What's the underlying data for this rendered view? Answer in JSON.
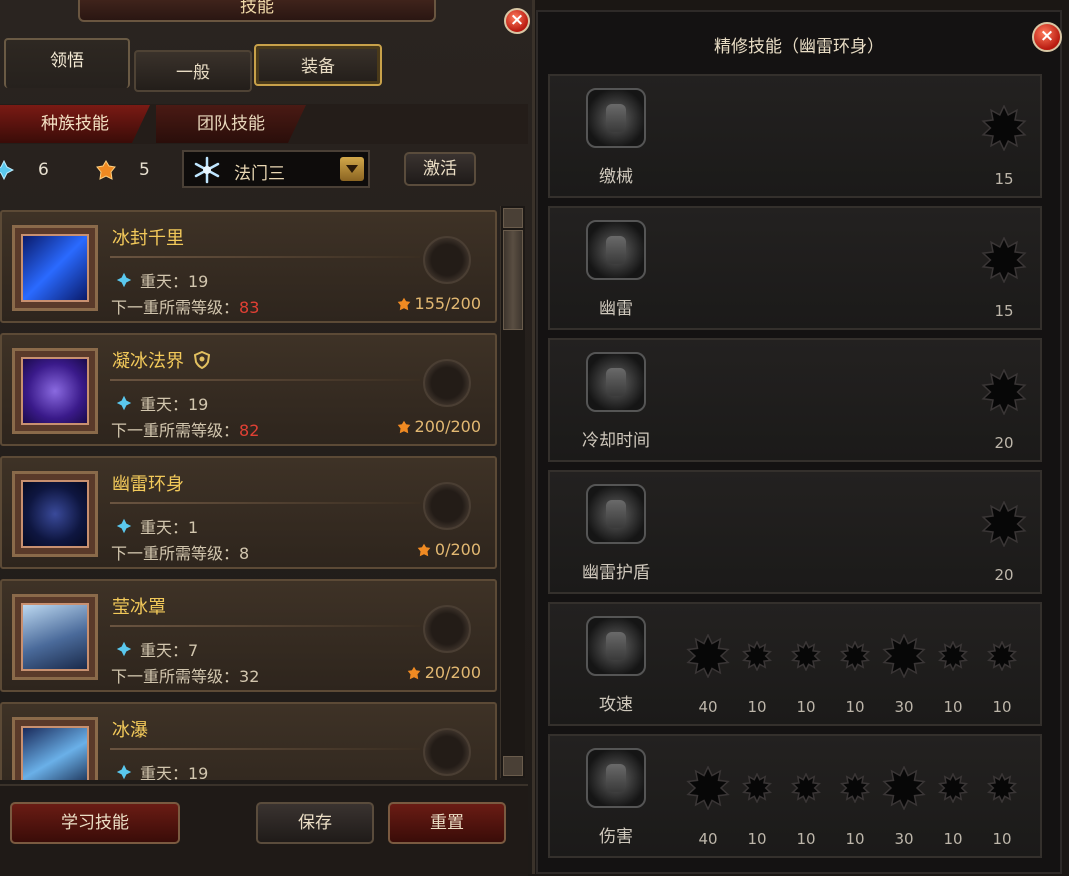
{
  "left": {
    "title": "技能",
    "tabs": [
      "领悟",
      "一般",
      "装备"
    ],
    "subtabs": [
      "种族技能",
      "团队技能"
    ],
    "resources": {
      "blue_count": "6",
      "orange_count": "5"
    },
    "dropdown": {
      "selected": "法门三"
    },
    "activate_label": "激活",
    "skills": [
      {
        "name": "冰封千里",
        "level": "重天：19",
        "req_prefix": "下一重所需等级：",
        "req_value": "83",
        "req_red": true,
        "cost": "155/200"
      },
      {
        "name": "凝冰法界",
        "level": "重天：19",
        "req_prefix": "下一重所需等级：",
        "req_value": "82",
        "req_red": true,
        "cost": "200/200"
      },
      {
        "name": "幽雷环身",
        "level": "重天：1",
        "req_prefix": "下一重所需等级：",
        "req_value": "8",
        "req_red": false,
        "cost": "0/200"
      },
      {
        "name": "莹冰罩",
        "level": "重天：7",
        "req_prefix": "下一重所需等级：",
        "req_value": "32",
        "req_red": false,
        "cost": "20/200"
      },
      {
        "name": "冰瀑",
        "level": "重天：19"
      }
    ],
    "buttons": {
      "learn": "学习技能",
      "save": "保存",
      "reset": "重置"
    }
  },
  "right": {
    "title": "精修技能（幽雷环身）",
    "rows": [
      {
        "label": "缴械",
        "nodes": [
          "15"
        ]
      },
      {
        "label": "幽雷",
        "nodes": [
          "15"
        ]
      },
      {
        "label": "冷却时间",
        "nodes": [
          "20"
        ]
      },
      {
        "label": "幽雷护盾",
        "nodes": [
          "20"
        ]
      },
      {
        "label": "攻速",
        "nodes": [
          "40",
          "10",
          "10",
          "10",
          "30",
          "10",
          "10"
        ]
      },
      {
        "label": "伤害",
        "nodes": [
          "40",
          "10",
          "10",
          "10",
          "30",
          "10",
          "10"
        ]
      }
    ]
  },
  "colors": {
    "gold_text": "#f2c95a",
    "red_value": "#e04034",
    "accent_frame": "#c8a14a"
  },
  "icons": [
    "close-icon",
    "blue-gem-icon",
    "orange-gem-icon",
    "snowflake-icon",
    "dropdown-arrow-icon",
    "shield-icon",
    "skill-node-icon"
  ]
}
